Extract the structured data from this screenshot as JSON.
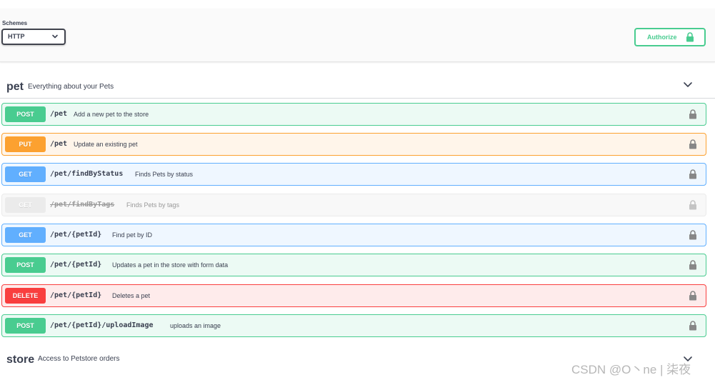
{
  "schemes": {
    "label": "Schemes",
    "selected": "HTTP"
  },
  "authorize": {
    "label": "Authorize"
  },
  "tags": [
    {
      "name": "pet",
      "description": "Everything about your Pets",
      "operations": [
        {
          "method": "POST",
          "path": "/pet",
          "summary": "Add a new pet to the store"
        },
        {
          "method": "PUT",
          "path": "/pet",
          "summary": "Update an existing pet"
        },
        {
          "method": "GET",
          "path": "/pet/findByStatus",
          "summary": "Finds Pets by status"
        },
        {
          "method": "GET",
          "path": "/pet/findByTags",
          "summary": "Finds Pets by tags",
          "deprecated": true
        },
        {
          "method": "GET",
          "path": "/pet/{petId}",
          "summary": "Find pet by ID"
        },
        {
          "method": "POST",
          "path": "/pet/{petId}",
          "summary": "Updates a pet in the store with form data"
        },
        {
          "method": "DELETE",
          "path": "/pet/{petId}",
          "summary": "Deletes a pet"
        },
        {
          "method": "POST",
          "path": "/pet/{petId}/uploadImage",
          "summary": "uploads an image"
        }
      ]
    },
    {
      "name": "store",
      "description": "Access to Petstore orders"
    }
  ],
  "colors": {
    "post": "#49cc90",
    "put": "#fca130",
    "get": "#61affe",
    "delete": "#f93e3e",
    "deprecated": "#ebebeb"
  },
  "watermark": "CSDN @O丶ne | 柒夜"
}
